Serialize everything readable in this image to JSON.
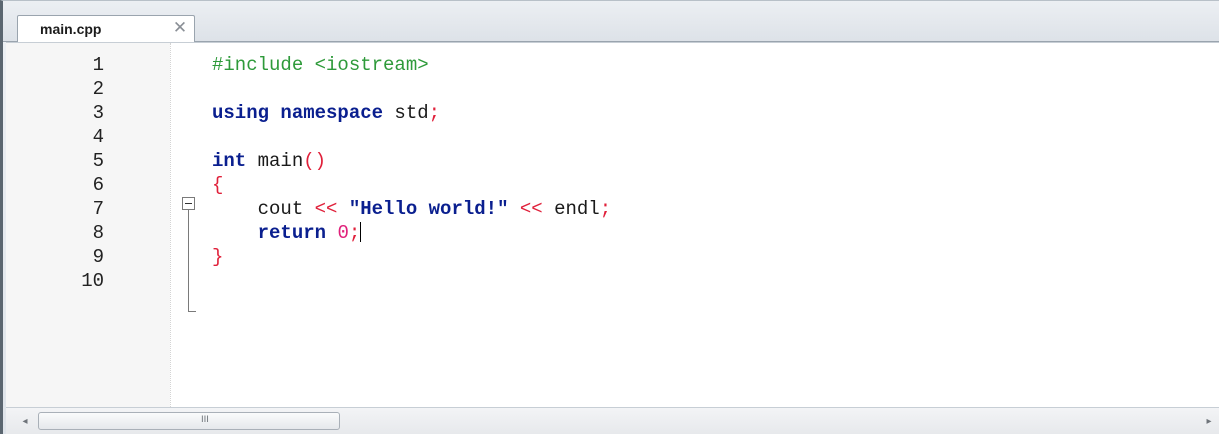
{
  "tabs": [
    {
      "label": "main.cpp",
      "close_icon": "close-icon"
    }
  ],
  "editor": {
    "line_numbers": [
      "1",
      "2",
      "3",
      "4",
      "5",
      "6",
      "7",
      "8",
      "9",
      "10"
    ],
    "lines": [
      [
        {
          "t": "#include <iostream>",
          "c": "pp"
        }
      ],
      [],
      [
        {
          "t": "using namespace",
          "c": "kw"
        },
        {
          "t": " std",
          "c": "id"
        },
        {
          "t": ";",
          "c": "op"
        }
      ],
      [],
      [
        {
          "t": "int",
          "c": "kw"
        },
        {
          "t": " main",
          "c": "id"
        },
        {
          "t": "()",
          "c": "op"
        }
      ],
      [
        {
          "t": "{",
          "c": "op"
        }
      ],
      [
        {
          "t": "    cout ",
          "c": "id"
        },
        {
          "t": "<<",
          "c": "op"
        },
        {
          "t": " ",
          "c": "id"
        },
        {
          "t": "\"Hello world!\"",
          "c": "str"
        },
        {
          "t": " ",
          "c": "id"
        },
        {
          "t": "<<",
          "c": "op"
        },
        {
          "t": " endl",
          "c": "id"
        },
        {
          "t": ";",
          "c": "op"
        }
      ],
      [
        {
          "t": "    ",
          "c": "id"
        },
        {
          "t": "return",
          "c": "kw"
        },
        {
          "t": " ",
          "c": "id"
        },
        {
          "t": "0",
          "c": "num"
        },
        {
          "t": ";",
          "c": "op"
        },
        {
          "caret": true
        }
      ],
      [
        {
          "t": "}",
          "c": "op"
        }
      ],
      []
    ],
    "fold_icon": "fold-collapse-icon"
  },
  "scrollbar": {
    "left_arrow": "◂",
    "right_arrow": "▸",
    "grip": "III"
  },
  "colors": {
    "keyword": "#0a1f8f",
    "preprocessor": "#2e9a3a",
    "operator": "#e0203a",
    "number": "#e0207a"
  }
}
